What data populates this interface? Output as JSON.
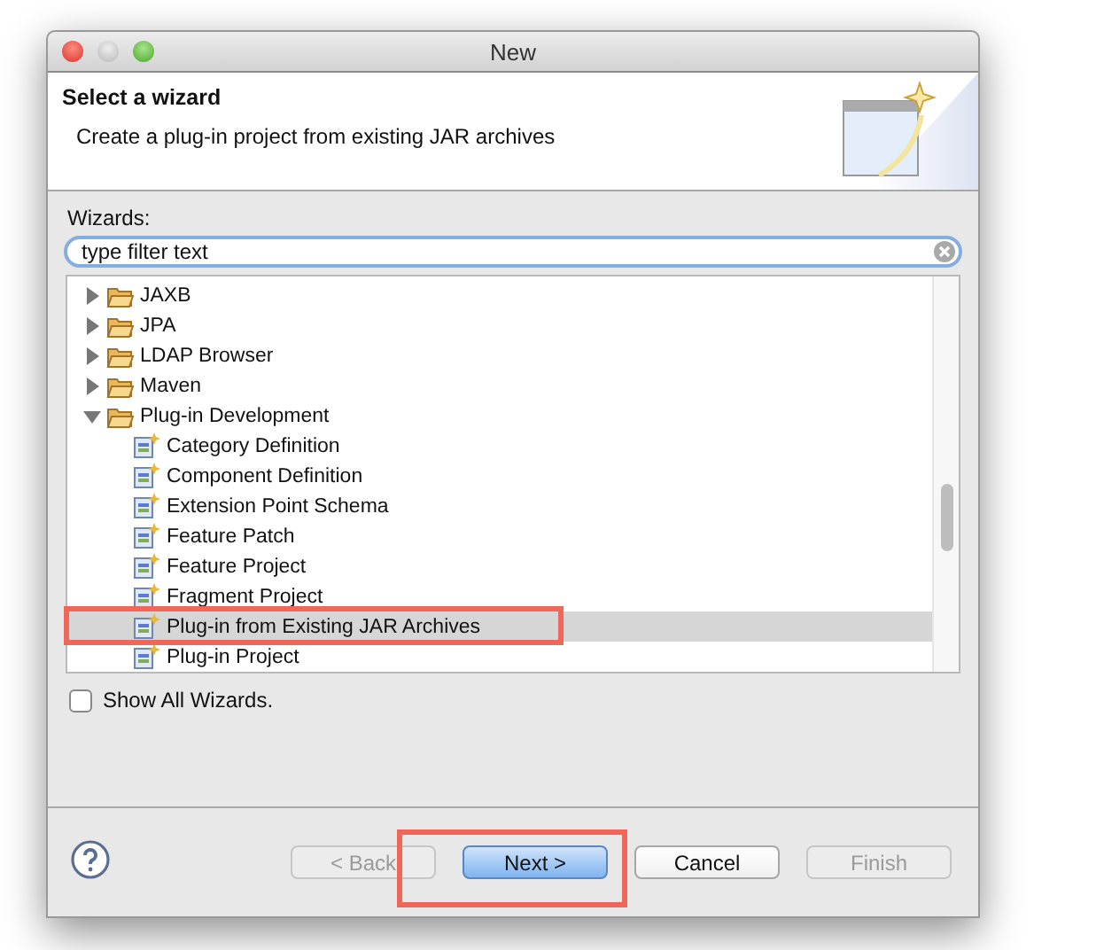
{
  "window": {
    "title": "New"
  },
  "header": {
    "title": "Select a wizard",
    "description": "Create a plug-in project from existing JAR archives"
  },
  "wizards_label": "Wizards:",
  "filter": {
    "value": "type filter text"
  },
  "tree": [
    {
      "label": "JAXB",
      "expanded": false,
      "selected": false
    },
    {
      "label": "JPA",
      "expanded": false,
      "selected": false
    },
    {
      "label": "LDAP Browser",
      "expanded": false,
      "selected": false
    },
    {
      "label": "Maven",
      "expanded": false,
      "selected": false
    },
    {
      "label": "Plug-in Development",
      "expanded": true,
      "selected": false,
      "children": [
        {
          "label": "Category Definition",
          "selected": false
        },
        {
          "label": "Component Definition",
          "selected": false
        },
        {
          "label": "Extension Point Schema",
          "selected": false
        },
        {
          "label": "Feature Patch",
          "selected": false
        },
        {
          "label": "Feature Project",
          "selected": false
        },
        {
          "label": "Fragment Project",
          "selected": false
        },
        {
          "label": "Plug-in from Existing JAR Archives",
          "selected": true
        },
        {
          "label": "Plug-in Project",
          "selected": false
        }
      ]
    }
  ],
  "show_all": {
    "label": "Show All Wizards.",
    "checked": false
  },
  "buttons": [
    {
      "label": "< Back",
      "disabled": true,
      "default": false
    },
    {
      "label": "Next >",
      "disabled": false,
      "default": true
    },
    {
      "label": "Cancel",
      "disabled": false,
      "default": false
    },
    {
      "label": "Finish",
      "disabled": true,
      "default": false
    }
  ]
}
